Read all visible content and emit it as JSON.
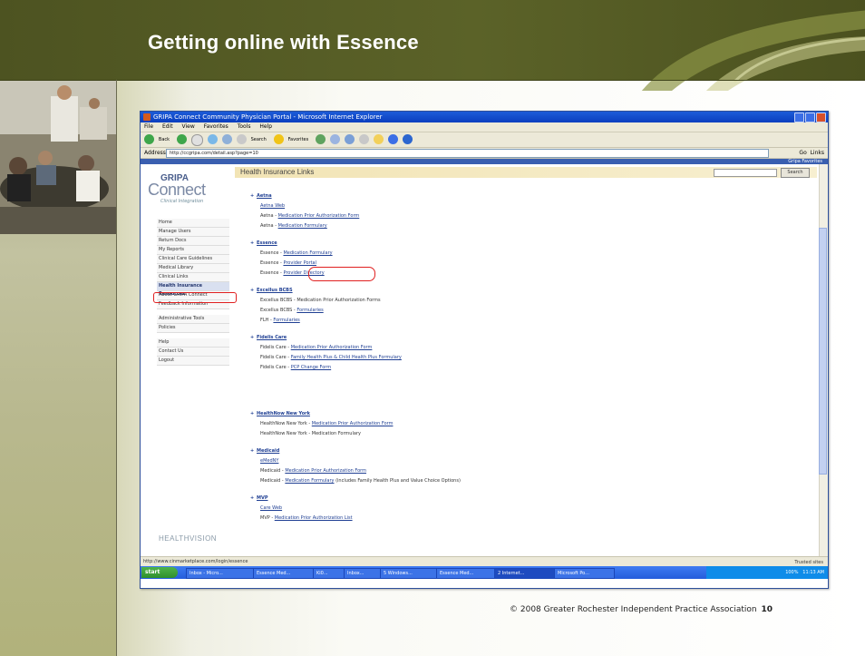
{
  "slide": {
    "title": "Getting online with Essence",
    "footer_text": "© 2008 Greater Rochester Independent Practice Association",
    "page_number": "10"
  },
  "browser": {
    "window_title": "GRIPA Connect Community Physician Portal - Microsoft Internet Explorer",
    "menu": [
      "File",
      "Edit",
      "View",
      "Favorites",
      "Tools",
      "Help"
    ],
    "toolbar_back": "Back",
    "toolbar_search": "Search",
    "toolbar_favorites": "Favorites",
    "address_label": "Address",
    "address_value": "http://ccgripa.com/detail.asp?page=10",
    "go_label": "Go",
    "links_label": "Links",
    "favorites_strip": "Gripa Favorites",
    "status_text": "http://www.cinmarketplace.com/login/essence",
    "status_zone": "Trusted sites"
  },
  "portal": {
    "brand_top": "GRIPA",
    "brand_main": "Connect",
    "brand_sub": "Clinical Integration",
    "nav": [
      "Home",
      "Manage Users",
      "Return Docs",
      "My Reports",
      "Clinical Care Guidelines",
      "Medical Library",
      "Clinical Links",
      "Health Insurance Resources",
      "About GRIPA Connect",
      "Feedback Information",
      "Administrative Tools",
      "Policies",
      "Help",
      "Contact Us",
      "Logout"
    ],
    "header_title": "Health Insurance Links",
    "search_button": "Search",
    "footer_logo": "HEALTHVISION"
  },
  "links": {
    "aetna": {
      "name": "Aetna",
      "row1": "Aetna Web",
      "row2_prefix": "Aetna -",
      "row2_link": "Medication Prior Authorization Form",
      "row3_prefix": "Aetna -",
      "row3_link": "Medication Formulary"
    },
    "essence": {
      "name": "Essence",
      "row1_prefix": "Essence -",
      "row1_link": "Medication Formulary",
      "row2_prefix": "Essence -",
      "row2_link": "Provider Portal",
      "row3_prefix": "Essence -",
      "row3_link": "Provider Directory"
    },
    "excellus": {
      "name": "Excellus BCBS",
      "row1": "Excellus BCBS - Medication Prior Authorization Forms",
      "row2_prefix": "Excellus BCBS -",
      "row2_link": "Formularies",
      "row3_prefix": "FLH -",
      "row3_link": "Formularies"
    },
    "fidelis": {
      "name": "Fidelis Care",
      "row1_prefix": "Fidelis Care -",
      "row1_link": "Medication Prior Authorization Form",
      "row2_prefix": "Fidelis Care -",
      "row2_link": "Family Health Plus & Child Health Plus Formulary",
      "row3_prefix": "Fidelis Care -",
      "row3_link": "PCP Change Form"
    },
    "healthnow": {
      "name": "HealthNow New York",
      "row1_prefix": "HealthNow New York -",
      "row1_link": "Medication Prior Authorization Form",
      "row2": "HealthNow New York - Medication Formulary"
    },
    "medicaid": {
      "name": "Medicaid",
      "row1": "eMedNY",
      "row2_prefix": "Medicaid -",
      "row2_link": "Medication Prior Authorization Form",
      "row3_prefix": "Medicaid -",
      "row3_link": "Medication Formulary",
      "row3_suffix": "(includes Family Health Plus and Value Choice Options)"
    },
    "mvp": {
      "name": "MVP",
      "row1": "Care Web",
      "row2_prefix": "MVP -",
      "row2_link": "Medication Prior Authorization List"
    }
  },
  "taskbar": {
    "start": "start",
    "items": [
      "Inbox - Micro...",
      "Essence Med...",
      "Ki0...",
      "Inbox...",
      "5 Windows...",
      "Essence Med...",
      "2 Internet...",
      "Microsoft Po..."
    ],
    "zoom": "100%",
    "clock": "11:13 AM"
  }
}
